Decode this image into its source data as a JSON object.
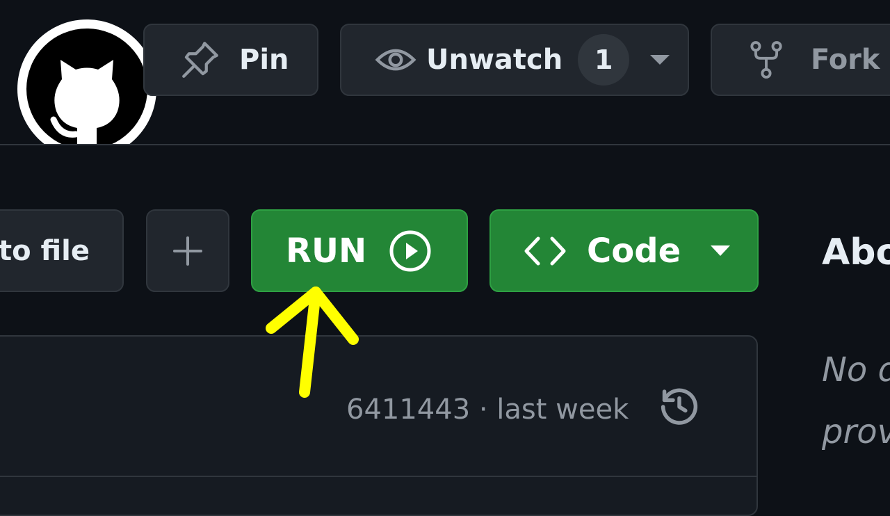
{
  "header": {
    "pin_label": "Pin",
    "unwatch_label": "Unwatch",
    "watch_count": "1",
    "fork_label": "Fork"
  },
  "toolbar": {
    "goto_file_label": "to file",
    "plus_symbol": "+",
    "run_label": "RUN",
    "code_label": "Code"
  },
  "commit": {
    "info": "6411443 · last week"
  },
  "sidebar": {
    "about_heading": "Abo",
    "description_line1": "No d",
    "description_line2": "prov"
  },
  "icons": [
    "github-logo-icon",
    "pin-icon",
    "eye-icon",
    "chevron-down-icon",
    "fork-icon",
    "plus-icon",
    "play-circle-icon",
    "code-icon",
    "history-icon",
    "arrow-up-icon"
  ],
  "colors": {
    "background": "#0d1117",
    "button_bg": "#21262d",
    "border": "#30363d",
    "primary_green": "#238636",
    "muted_text": "#9198a1",
    "annotation_yellow": "#ffff00"
  }
}
